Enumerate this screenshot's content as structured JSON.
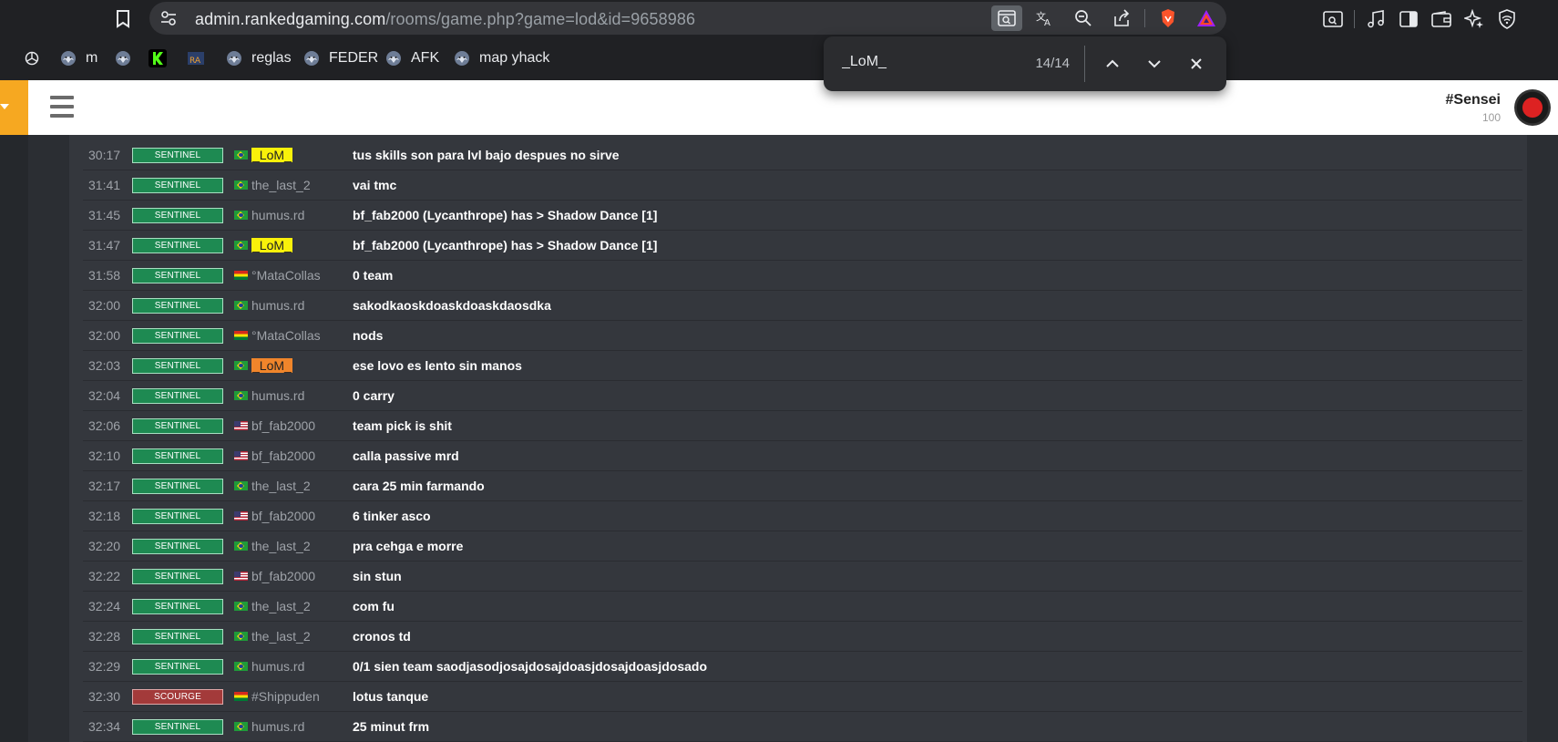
{
  "browser": {
    "url_host": "admin.rankedgaming.com",
    "url_path": "/rooms/game.php?game=lod&id=9658986",
    "bookmarks": [
      {
        "label": "",
        "icon": "chatgpt-icon"
      },
      {
        "label": "m",
        "icon": "wolf-icon"
      },
      {
        "label": "",
        "icon": "wolf-icon"
      },
      {
        "label": "",
        "icon": "k-logo-icon"
      },
      {
        "label": "",
        "icon": "rg-icon"
      },
      {
        "label": "reglas",
        "icon": "wolf-icon"
      },
      {
        "label": "FEDER",
        "icon": "wolf-icon"
      },
      {
        "label": "AFK",
        "icon": "wolf-icon"
      },
      {
        "label": "map yhack",
        "icon": "wolf-icon"
      }
    ]
  },
  "find": {
    "query": "_LoM_",
    "count": "14/14"
  },
  "header": {
    "user_name": "#Sensei",
    "user_points": "100"
  },
  "chat": [
    {
      "time": "30:17",
      "team": "SENTINEL",
      "flag": "br",
      "player": "_LoM_",
      "highlight": "match",
      "message": "tus skills son para lvl bajo despues no sirve"
    },
    {
      "time": "31:41",
      "team": "SENTINEL",
      "flag": "br",
      "player": "the_last_2",
      "highlight": "",
      "message": "vai tmc"
    },
    {
      "time": "31:45",
      "team": "SENTINEL",
      "flag": "br",
      "player": "humus.rd",
      "highlight": "",
      "message": "bf_fab2000 (Lycanthrope) has > Shadow Dance [1]"
    },
    {
      "time": "31:47",
      "team": "SENTINEL",
      "flag": "br",
      "player": "_LoM_",
      "highlight": "match",
      "message": "bf_fab2000 (Lycanthrope) has > Shadow Dance [1]"
    },
    {
      "time": "31:58",
      "team": "SENTINEL",
      "flag": "bo",
      "player": "°MataCollas",
      "highlight": "",
      "message": "0 team"
    },
    {
      "time": "32:00",
      "team": "SENTINEL",
      "flag": "br",
      "player": "humus.rd",
      "highlight": "",
      "message": "sakodkaoskdoaskdoaskdaosdka"
    },
    {
      "time": "32:00",
      "team": "SENTINEL",
      "flag": "bo",
      "player": "°MataCollas",
      "highlight": "",
      "message": "nods"
    },
    {
      "time": "32:03",
      "team": "SENTINEL",
      "flag": "br",
      "player": "_LoM_",
      "highlight": "active",
      "message": "ese lovo es lento sin manos"
    },
    {
      "time": "32:04",
      "team": "SENTINEL",
      "flag": "br",
      "player": "humus.rd",
      "highlight": "",
      "message": "0 carry"
    },
    {
      "time": "32:06",
      "team": "SENTINEL",
      "flag": "us",
      "player": "bf_fab2000",
      "highlight": "",
      "message": "team pick is shit"
    },
    {
      "time": "32:10",
      "team": "SENTINEL",
      "flag": "us",
      "player": "bf_fab2000",
      "highlight": "",
      "message": "calla passive mrd"
    },
    {
      "time": "32:17",
      "team": "SENTINEL",
      "flag": "br",
      "player": "the_last_2",
      "highlight": "",
      "message": "cara 25 min farmando"
    },
    {
      "time": "32:18",
      "team": "SENTINEL",
      "flag": "us",
      "player": "bf_fab2000",
      "highlight": "",
      "message": "6 tinker asco"
    },
    {
      "time": "32:20",
      "team": "SENTINEL",
      "flag": "br",
      "player": "the_last_2",
      "highlight": "",
      "message": "pra cehga e morre"
    },
    {
      "time": "32:22",
      "team": "SENTINEL",
      "flag": "us",
      "player": "bf_fab2000",
      "highlight": "",
      "message": "sin stun"
    },
    {
      "time": "32:24",
      "team": "SENTINEL",
      "flag": "br",
      "player": "the_last_2",
      "highlight": "",
      "message": "com fu"
    },
    {
      "time": "32:28",
      "team": "SENTINEL",
      "flag": "br",
      "player": "the_last_2",
      "highlight": "",
      "message": "cronos td"
    },
    {
      "time": "32:29",
      "team": "SENTINEL",
      "flag": "br",
      "player": "humus.rd",
      "highlight": "",
      "message": "0/1 sien team saodjasodjosajdosajdoasjdosajdoasjdosado"
    },
    {
      "time": "32:30",
      "team": "SCOURGE",
      "flag": "bo",
      "player": "#Shippuden",
      "highlight": "",
      "message": "lotus tanque"
    },
    {
      "time": "32:34",
      "team": "SENTINEL",
      "flag": "br",
      "player": "humus.rd",
      "highlight": "",
      "message": "25 minut frm"
    }
  ],
  "colors": {
    "sentinel": "#1e8a52",
    "scourge": "#a33a3a",
    "match_highlight": "#f9f10a",
    "active_highlight": "#f0852b",
    "header_accent": "#f6a821"
  }
}
